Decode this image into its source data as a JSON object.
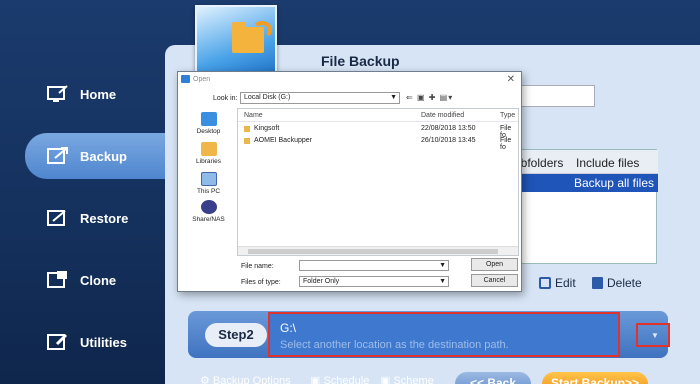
{
  "sidebar": {
    "items": [
      {
        "label": "Home",
        "icon": "home-icon"
      },
      {
        "label": "Backup",
        "icon": "backup-icon",
        "active": true
      },
      {
        "label": "Restore",
        "icon": "restore-icon"
      },
      {
        "label": "Clone",
        "icon": "clone-icon"
      },
      {
        "label": "Utilities",
        "icon": "utilities-icon"
      }
    ]
  },
  "main": {
    "title": "File Backup",
    "source_table": {
      "headers": [
        "ubfolders",
        "Include files"
      ],
      "row": "Backup all files"
    },
    "actions": {
      "edit": "Edit",
      "delete": "Delete"
    },
    "step2": {
      "label": "Step2",
      "value": "G:\\",
      "placeholder": "Select another location as the destination path."
    }
  },
  "footer": {
    "backup_options": "Backup Options",
    "schedule": "Schedule",
    "scheme": "Scheme",
    "back": "<< Back",
    "start_backup": "Start Backup>>"
  },
  "dialog": {
    "title": "Open",
    "look_in_label": "Look in:",
    "look_in_value": "Local Disk (G:)",
    "places": [
      "Desktop",
      "Libraries",
      "This PC",
      "Share/NAS"
    ],
    "columns": [
      "Name",
      "Date modified",
      "Type"
    ],
    "files": [
      {
        "name": "Kingsoft",
        "date": "22/08/2018 13:50",
        "type": "File fo"
      },
      {
        "name": "AOMEI Backupper",
        "date": "26/10/2018 13:45",
        "type": "File fo"
      }
    ],
    "file_name_label": "File name:",
    "file_name_value": "",
    "file_type_label": "Files of type:",
    "file_type_value": "Folder Only",
    "open_button": "Open",
    "cancel_button": "Cancel"
  },
  "colors": {
    "accent": "#3f78cf",
    "highlight_border": "#e0332e",
    "start": "#f08b12"
  }
}
